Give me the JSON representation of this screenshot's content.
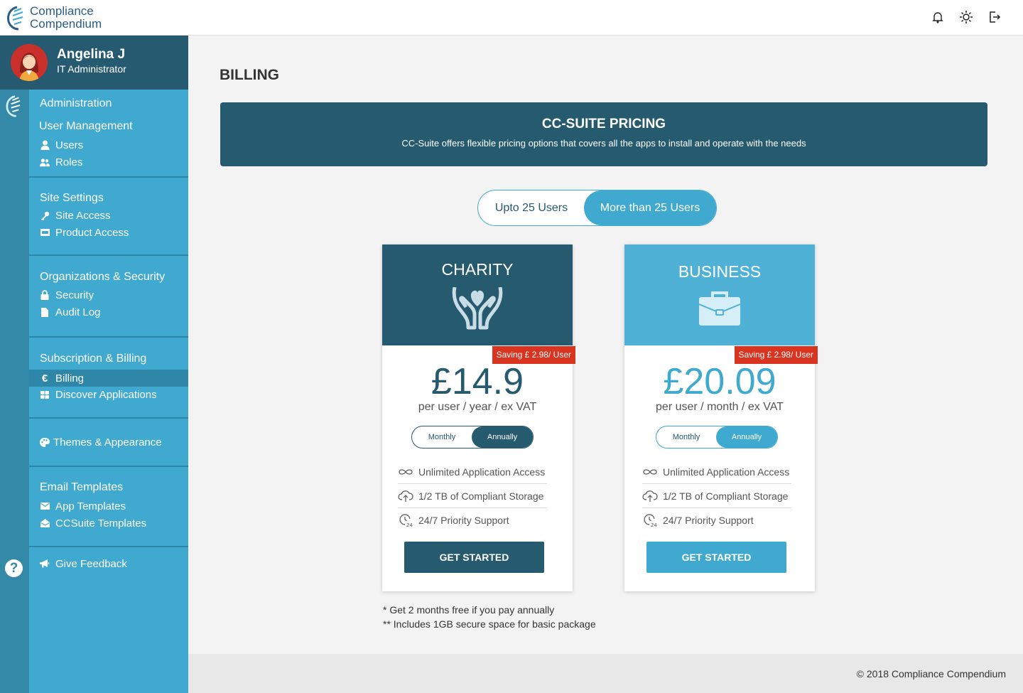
{
  "brand": {
    "line1": "Compliance",
    "line2": "Compendium"
  },
  "topbar": {
    "icons": [
      "bell-icon",
      "sun-icon",
      "logout-icon"
    ]
  },
  "profile": {
    "name": "Angelina J",
    "role": "IT Administrator"
  },
  "sidebar": {
    "admin": {
      "title": "Administration",
      "group": "User Management",
      "items": [
        {
          "label": "Users",
          "icon": "user-icon"
        },
        {
          "label": "Roles",
          "icon": "users-icon"
        }
      ]
    },
    "site": {
      "title": "Site Settings",
      "items": [
        {
          "label": "Site Access",
          "icon": "key-icon"
        },
        {
          "label": "Product Access",
          "icon": "card-icon"
        }
      ]
    },
    "org": {
      "title": "Organizations & Security",
      "items": [
        {
          "label": "Security",
          "icon": "lock-icon"
        },
        {
          "label": "Audit Log",
          "icon": "file-icon"
        }
      ]
    },
    "sub": {
      "title": "Subscription & Billing",
      "items": [
        {
          "label": "Billing",
          "icon": "euro-icon"
        },
        {
          "label": "Discover Applications",
          "icon": "grid-icon"
        }
      ]
    },
    "themes": {
      "label": "Themes & Appearance",
      "icon": "palette-icon"
    },
    "email": {
      "title": "Email Templates",
      "items": [
        {
          "label": "App Templates",
          "icon": "envelope-icon"
        },
        {
          "label": "CCSuite Templates",
          "icon": "envelope-open-icon"
        }
      ]
    },
    "feedback": {
      "label": "Give Feedback",
      "icon": "megaphone-icon"
    }
  },
  "page": {
    "title": "BILLING"
  },
  "banner": {
    "title": "CC-SUITE PRICING",
    "subtitle": "CC-Suite offers flexible pricing options that covers all the apps to install and operate with the needs"
  },
  "user_toggle": {
    "left": "Upto 25 Users",
    "right": "More than 25 Users",
    "selected": "More than 25 Users"
  },
  "plans": [
    {
      "name": "CHARITY",
      "icon": "charity-hands-icon",
      "saving": "Saving  £ 2.98/ User",
      "price": "£14.9",
      "per": "per user / year / ex VAT",
      "toggle_left": "Monthly",
      "toggle_right": "Annually",
      "selected": "Annually",
      "cta": "GET STARTED",
      "color": "#265a6e"
    },
    {
      "name": "BUSINESS",
      "icon": "briefcase-icon",
      "saving": "Saving  £ 2.98/ User",
      "price": "£20.09",
      "per": "per user / month / ex VAT",
      "toggle_left": "Monthly",
      "toggle_right": "Annually",
      "selected": "Annually",
      "cta": "GET STARTED",
      "color": "#3fa9d0"
    }
  ],
  "features": [
    {
      "label": "Unlimited Application Access",
      "icon": "infinity-icon"
    },
    {
      "label": "1/2 TB of Compliant Storage",
      "icon": "cloud-upload-icon"
    },
    {
      "label": "24/7 Priority Support",
      "icon": "support-24-icon"
    }
  ],
  "notes": [
    "* Get 2 months free if you pay annually",
    "** Includes 1GB secure space for basic package"
  ],
  "footer": "© 2018 Compliance Compendium",
  "colors": {
    "dark": "#265a6e",
    "accent": "#3fa9d0",
    "rail": "#3488a8",
    "saving": "#d9341f"
  }
}
